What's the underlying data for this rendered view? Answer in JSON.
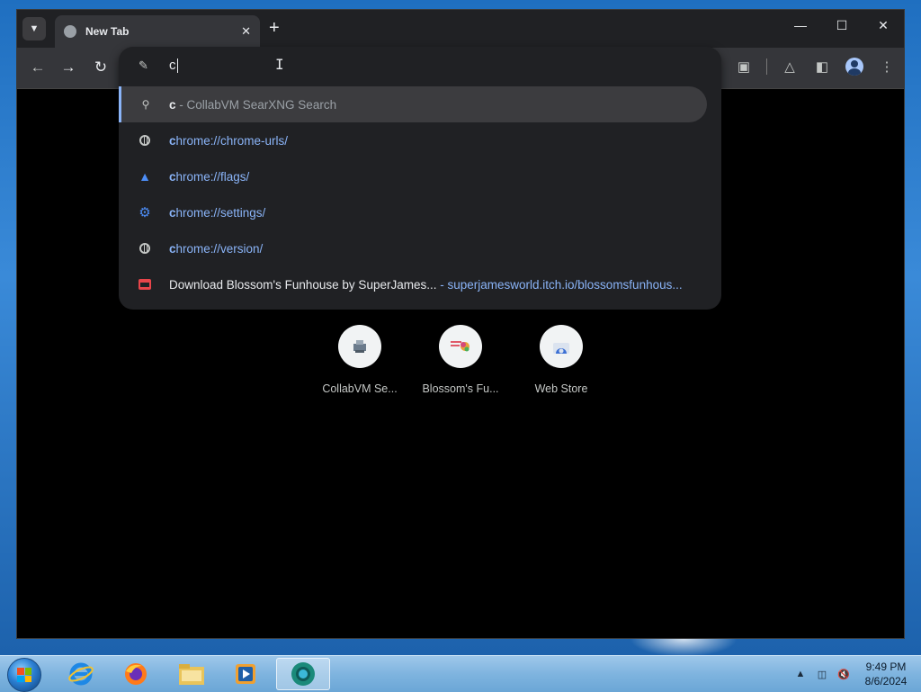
{
  "browser": {
    "tab": {
      "title": "New Tab"
    },
    "omnibox": {
      "input_value": "c",
      "suggestions": [
        {
          "match": "c",
          "rest": " - CollabVM SearXNG Search",
          "url": "",
          "icon": "search-icon"
        },
        {
          "match": "c",
          "rest": "hrome://chrome-urls/",
          "url": "",
          "icon": "globe-icon"
        },
        {
          "match": "c",
          "rest": "hrome://flags/",
          "url": "",
          "icon": "flask-icon"
        },
        {
          "match": "c",
          "rest": "hrome://settings/",
          "url": "",
          "icon": "gear-icon"
        },
        {
          "match": "c",
          "rest": "hrome://version/",
          "url": "",
          "icon": "globe-icon"
        },
        {
          "match": "",
          "rest": "Download Blossom's Funhouse by SuperJames...",
          "url": " - superjamesworld.itch.io/blossomsfunhous...",
          "icon": "itch-store-icon"
        }
      ]
    },
    "shortcuts": [
      {
        "label": "CollabVM Se...",
        "icon": "collabvm-icon"
      },
      {
        "label": "Blossom's Fu...",
        "icon": "blossom-icon"
      },
      {
        "label": "Web Store",
        "icon": "web-store-icon"
      }
    ]
  },
  "taskbar": {
    "clock": {
      "time": "9:49 PM",
      "date": "8/6/2024"
    },
    "apps": [
      "internet-explorer-icon",
      "firefox-icon",
      "file-explorer-icon",
      "media-player-icon",
      "chrome-icon"
    ]
  },
  "colors": {
    "accent_link": "#8ab4f8",
    "toolbar": "#35363a",
    "dropdown": "#202124"
  }
}
